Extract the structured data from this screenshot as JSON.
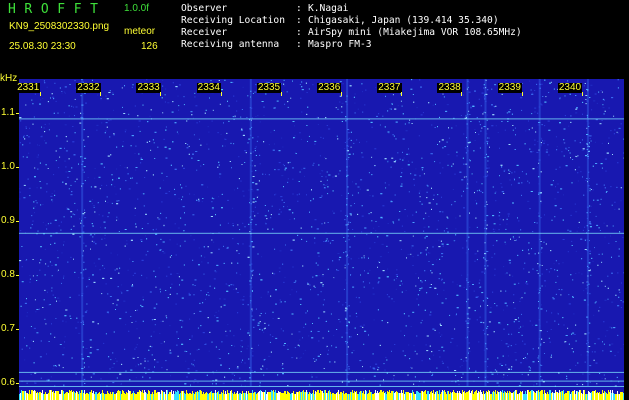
{
  "app": {
    "title": "HROFFT",
    "version": "1.0.0f"
  },
  "file": {
    "name": "KN9_2508302330.png",
    "datetime": "25.08.30 23:30",
    "meteor_label": "meteor",
    "meteor_count": "126"
  },
  "info": [
    {
      "label": "Observer",
      "value": "K.Nagai"
    },
    {
      "label": "Receiving Location",
      "value": "Chigasaki, Japan (139.414 35.340)"
    },
    {
      "label": "Receiver",
      "value": "AirSpy mini (Miakejima VOR 108.65MHz)"
    },
    {
      "label": "Receiving antenna",
      "value": "Maspro FM-3"
    }
  ],
  "info_separator": ":",
  "colors": {
    "background": "#000000",
    "plot_base": "#1818b0",
    "noise_bright": "#4fb8ff",
    "axis_text": "#ffff33",
    "title_green": "#3ee03a",
    "bottom_band": "#ffff00"
  },
  "chart_data": {
    "type": "heatmap",
    "ylabel": "kHz",
    "y_ticks": [
      "1.1",
      "1.0",
      "0.9",
      "0.8",
      "0.7",
      "0.6"
    ],
    "y_tick_values": [
      1.1,
      1.0,
      0.9,
      0.8,
      0.7,
      0.6
    ],
    "ylim": [
      0.568,
      1.163
    ],
    "x_ticks": [
      "2331",
      "2332",
      "2333",
      "2334",
      "2335",
      "2336",
      "2337",
      "2338",
      "2339",
      "2340"
    ],
    "x_tick_values": [
      2331,
      2332,
      2333,
      2334,
      2335,
      2336,
      2337,
      2338,
      2339,
      2340
    ],
    "xlim": [
      2330.65,
      2340.7
    ],
    "horizontal_lines_khz": [
      1.09,
      0.878,
      0.62,
      0.604,
      0.594
    ],
    "vertical_streaks": [
      2331.7,
      2334.5,
      2336.1,
      2338.1,
      2338.4,
      2339.3,
      2340.1
    ]
  }
}
